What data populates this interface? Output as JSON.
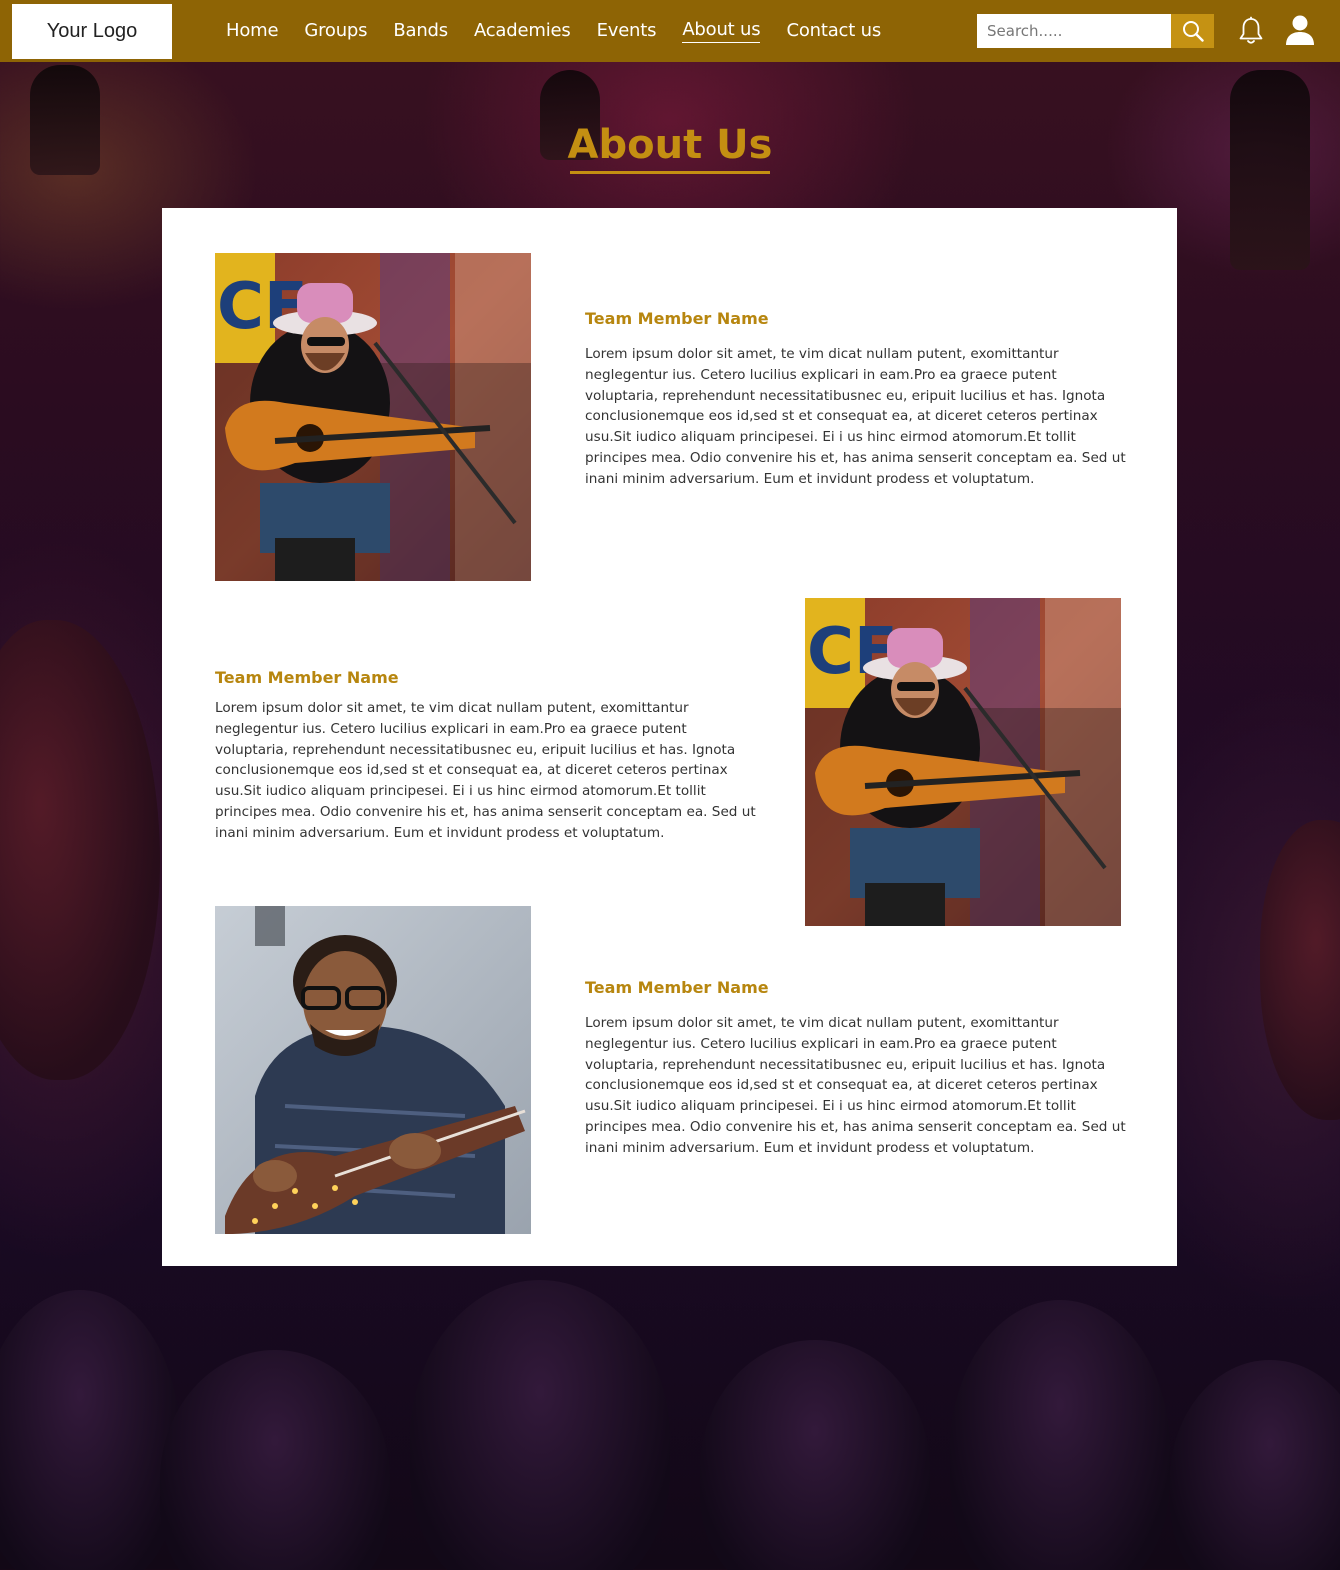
{
  "header": {
    "logo": "Your Logo",
    "nav": [
      "Home",
      "Groups",
      "Bands",
      "Academies",
      "Events",
      "About us",
      "Contact us"
    ],
    "active_nav": "About us",
    "search_placeholder": "Search.....",
    "accent_color": "#8e6405",
    "search_button_color": "#c59213"
  },
  "page": {
    "title": "About Us",
    "title_color": "#c48f12"
  },
  "members": [
    {
      "name": "Team Member Name",
      "bio": "Lorem ipsum dolor sit amet, te vim dicat nullam putent, exomittantur neglegentur ius. Cetero lucilius explicari in eam.Pro ea graece putent voluptaria, reprehendunt necessitatibusnec eu, eripuit lucilius et has. Ignota conclusionemque eos id,sed st et consequat ea, at diceret ceteros pertinax usu.Sit iudico aliquam principesei. Ei i us hinc eirmod atomorum.Et tollit principes mea. Odio convenire his et, has anima senserit conceptam ea. Sed ut inani minim adversarium. Eum et invidunt prodess et voluptatum.",
      "photo": "guitarist-hat-photo"
    },
    {
      "name": "Team Member Name",
      "bio": "Lorem ipsum dolor sit amet, te vim dicat nullam putent, exomittantur neglegentur ius. Cetero lucilius explicari in eam.Pro ea graece putent voluptaria, reprehendunt necessitatibusnec eu, eripuit lucilius et has. Ignota conclusionemque eos id,sed st et consequat ea, at diceret ceteros pertinax usu.Sit iudico aliquam principesei. Ei i us hinc eirmod atomorum.Et tollit principes mea. Odio convenire his et, has anima senserit conceptam ea. Sed ut inani minim adversarium. Eum et invidunt prodess et voluptatum.",
      "photo": "guitarist-hat-photo"
    },
    {
      "name": "Team Member Name",
      "bio": "Lorem ipsum dolor sit amet, te vim dicat nullam putent, exomittantur neglegentur ius. Cetero lucilius explicari in eam.Pro ea graece putent voluptaria, reprehendunt necessitatibusnec eu, eripuit lucilius et has. Ignota conclusionemque eos id,sed st et consequat ea, at diceret ceteros pertinax usu.Sit iudico aliquam principesei. Ei i us hinc eirmod atomorum.Et tollit principes mea. Odio convenire his et, has anima senserit conceptam ea. Sed ut inani minim adversarium. Eum et invidunt prodess et voluptatum.",
      "photo": "smiling-guitarist-photo"
    }
  ],
  "icons": {
    "search": "search-icon",
    "notifications": "bell-icon",
    "account": "user-icon"
  }
}
